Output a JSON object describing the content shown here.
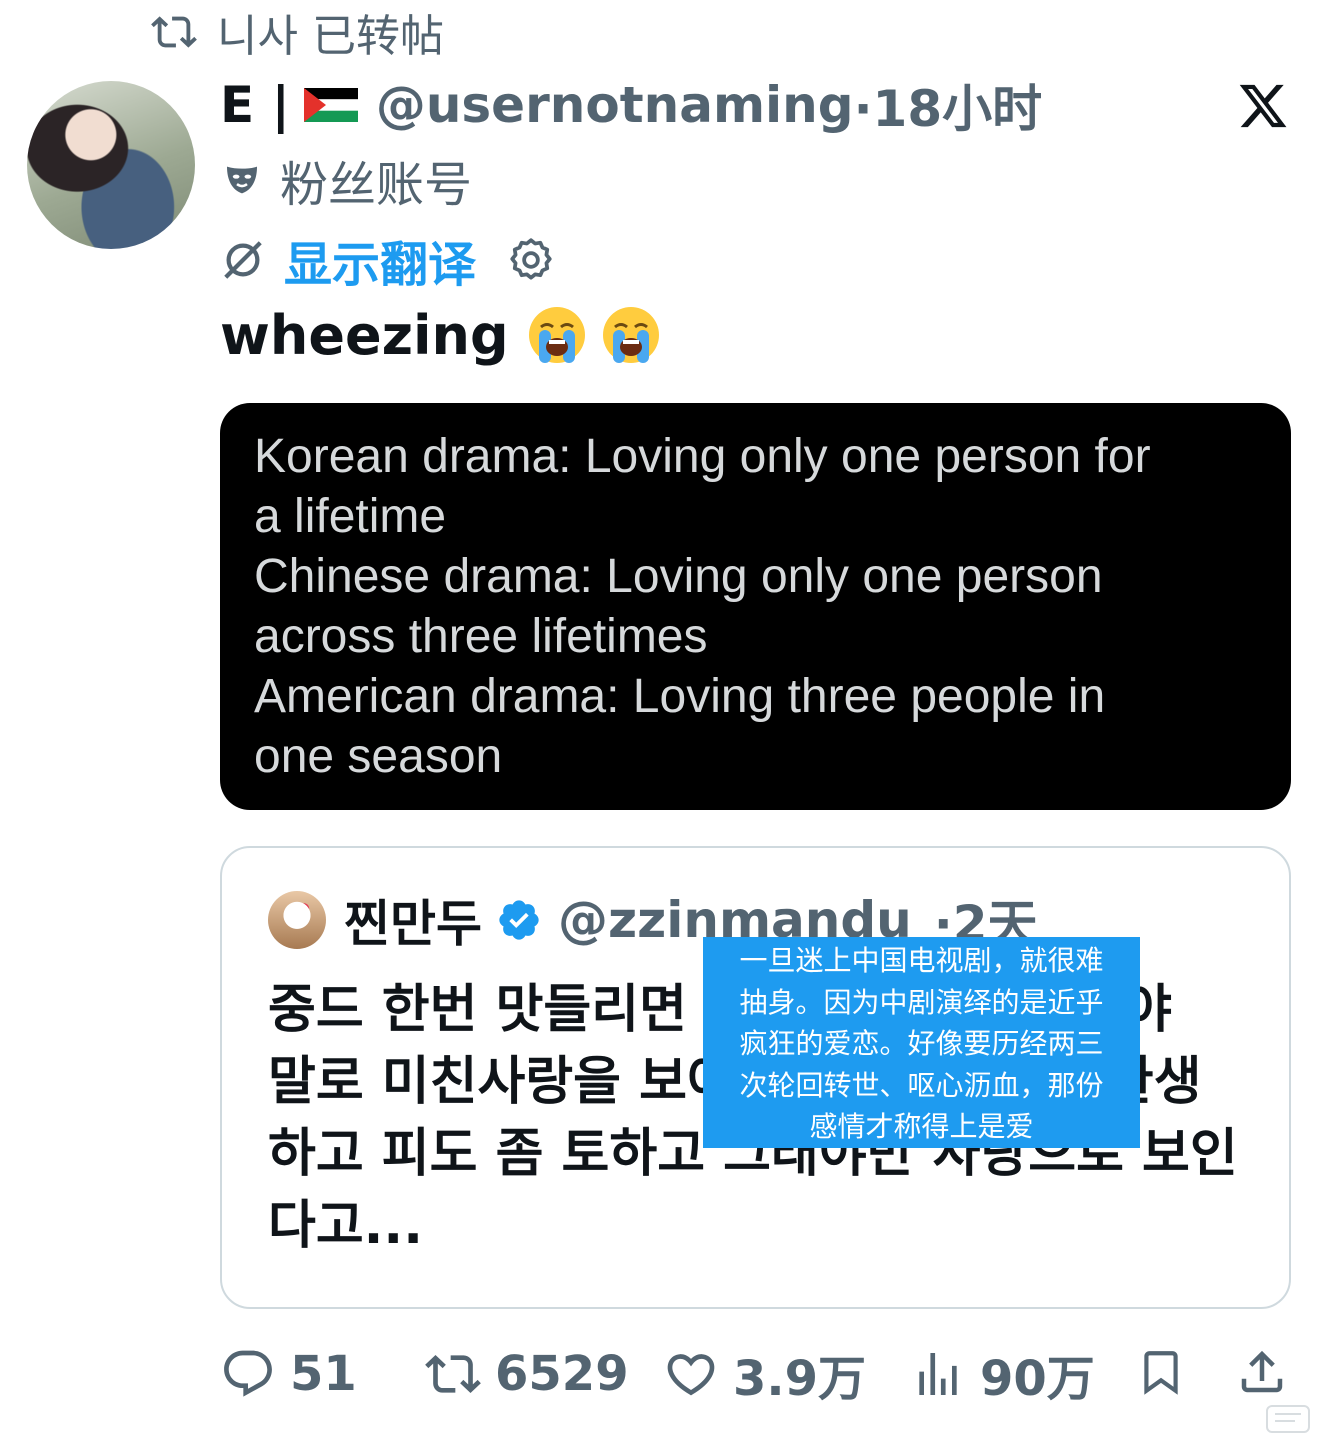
{
  "repost_bar": {
    "text": "니사 已转帖"
  },
  "author": {
    "name": "E |",
    "flag": "palestine-flag",
    "handle": "@usernotnaming",
    "time": "·18小时",
    "fan_label": "粉丝账号",
    "translate_label": "显示翻译"
  },
  "tweet": {
    "text": "wheezing",
    "emojis": [
      "loudly-crying-face",
      "loudly-crying-face"
    ]
  },
  "image_card": {
    "lines": [
      "Korean drama: Loving only one person for",
      "a lifetime",
      "Chinese drama: Loving only one person",
      "across three lifetimes",
      "American drama: Loving three people in",
      "one season"
    ]
  },
  "quote": {
    "name": "찐만두",
    "handle": "@zzinmandu",
    "time": "·2天",
    "lines": [
      "중드 한번 맛들리면 빠져나올 수 없다고야",
      "말로 미친사랑을 보여주잖아 두세번은 환생",
      "하고 피도 좀 토하고 그래야만 사랑으로 보인",
      "다고..."
    ]
  },
  "translation_overlay": {
    "lines": [
      "一旦迷上中国电视剧，就很难",
      "抽身。因为中剧演绎的是近乎",
      "疯狂的爱恋。好像要历经两三",
      "次轮回转世、呕心沥血，那份",
      "感情才称得上是爱"
    ]
  },
  "actions": {
    "replies": "51",
    "reposts": "6529",
    "likes": "3.9万",
    "views": "90万"
  },
  "colors": {
    "accent": "#1d9bf0",
    "secondary_text": "#536471",
    "overlay": "#1e9bf0"
  }
}
